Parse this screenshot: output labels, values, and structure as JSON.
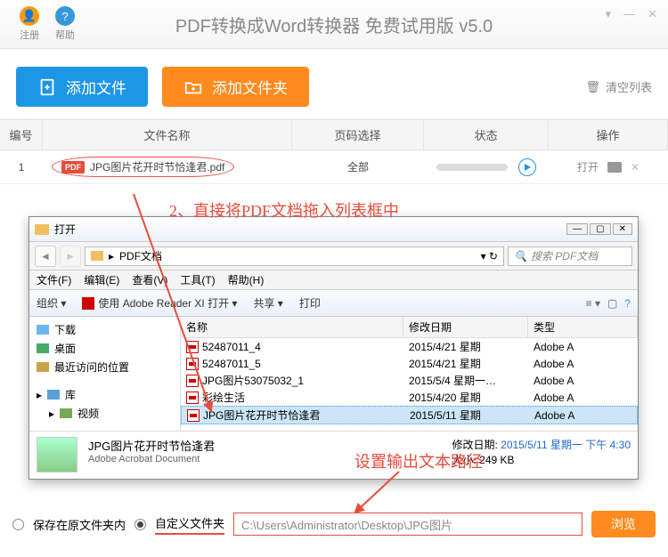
{
  "titlebar": {
    "register": "注册",
    "help": "帮助",
    "title": "PDF转换成Word转换器 免费试用版 v5.0"
  },
  "toolbar": {
    "add_file": "添加文件",
    "add_folder": "添加文件夹",
    "clear_list": "清空列表"
  },
  "table": {
    "headers": {
      "num": "编号",
      "name": "文件名称",
      "page": "页码选择",
      "status": "状态",
      "action": "操作"
    },
    "row": {
      "num": "1",
      "badge": "PDF",
      "name": "JPG图片花开时节恰逢君.pdf",
      "page": "全部",
      "open": "打开"
    }
  },
  "annotations": {
    "a1": "2、直接将PDF文档拖入列表框中",
    "a2": "设置输出文本路径"
  },
  "dialog": {
    "title": "打开",
    "crumb_folder": "PDF文档",
    "search_placeholder": "搜索 PDF文档",
    "menu": [
      "文件(F)",
      "编辑(E)",
      "查看(V)",
      "工具(T)",
      "帮助(H)"
    ],
    "tb": {
      "organize": "组织 ▾",
      "open_with": "使用 Adobe Reader XI 打开 ▾",
      "share": "共享 ▾",
      "print": "打印"
    },
    "sidebar": [
      {
        "icon": "#6bb4f0",
        "label": "下载"
      },
      {
        "icon": "#4a6",
        "label": "桌面"
      },
      {
        "icon": "#c9a24a",
        "label": "最近访问的位置"
      },
      {
        "icon": "#5aa0d8",
        "label": "库"
      },
      {
        "icon": "#7a5",
        "label": "视频"
      }
    ],
    "file_headers": {
      "name": "名称",
      "date": "修改日期",
      "type": "类型"
    },
    "files": [
      {
        "name": "52487011_4",
        "date": "2015/4/21 星期",
        "type": "Adobe A"
      },
      {
        "name": "52487011_5",
        "date": "2015/4/21 星期",
        "type": "Adobe A"
      },
      {
        "name": "JPG图片53075032_1",
        "date": "2015/5/4 星期一…",
        "type": "Adobe A"
      },
      {
        "name": "彩绘生活",
        "date": "2015/4/20 星期",
        "type": "Adobe A"
      },
      {
        "name": "JPG图片花开时节恰逢君",
        "date": "2015/5/11 星期",
        "type": "Adobe A",
        "selected": true
      }
    ],
    "footer": {
      "title": "JPG图片花开时节恰逢君",
      "subtitle": "Adobe Acrobat Document",
      "mod_label": "修改日期:",
      "mod_value": "2015/5/11 星期一 下午 4:30",
      "size_label": "大小:",
      "size_value": "249 KB"
    }
  },
  "bottom": {
    "save_orig": "保存在原文件夹内",
    "custom_folder": "自定义文件夹",
    "path": "C:\\Users\\Administrator\\Desktop\\JPG图片",
    "browse": "浏览"
  }
}
